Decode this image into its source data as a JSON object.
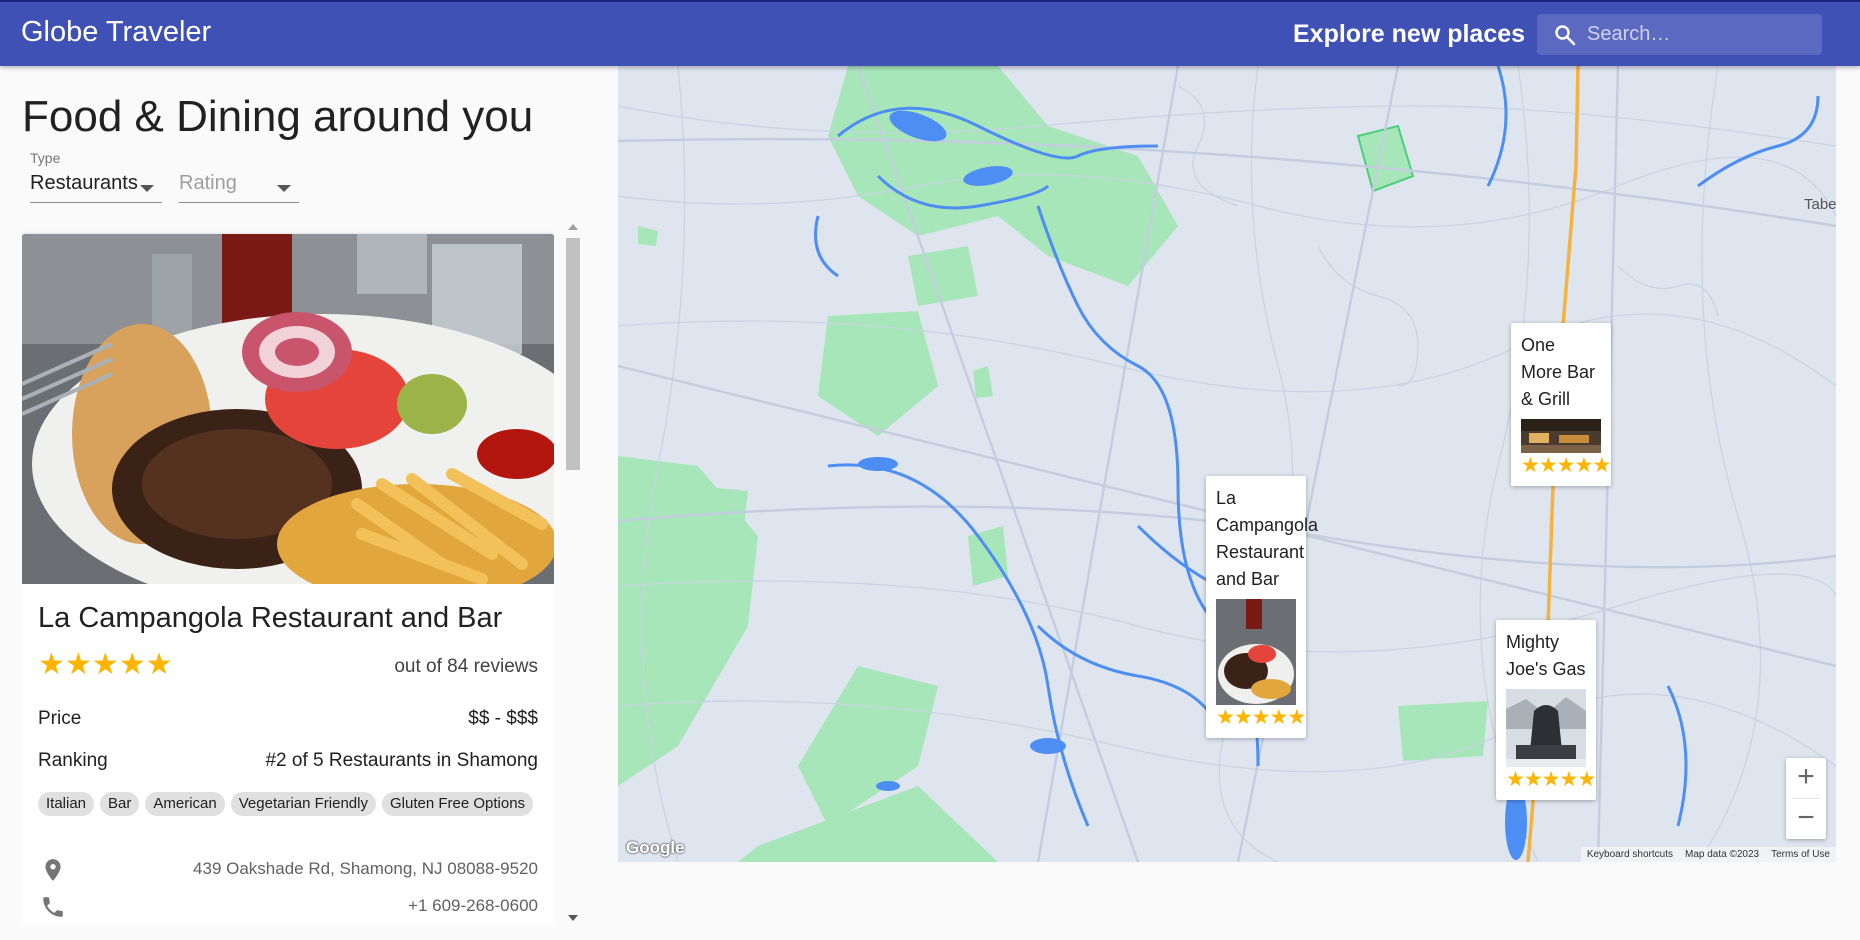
{
  "app": {
    "title": "Globe Traveler",
    "tagline": "Explore new places",
    "search_placeholder": "Search…"
  },
  "page": {
    "heading": "Food & Dining around you",
    "filters": {
      "type_label": "Type",
      "type_value": "Restaurants",
      "rating_value": "Rating"
    }
  },
  "card": {
    "name": "La Campangola Restaurant and Bar",
    "rating_stars": 5,
    "reviews_text": "out of 84 reviews",
    "price_label": "Price",
    "price_value": "$$ - $$$",
    "ranking_label": "Ranking",
    "ranking_value": "#2 of 5 Restaurants in Shamong",
    "tags": [
      "Italian",
      "Bar",
      "American",
      "Vegetarian Friendly",
      "Gluten Free Options"
    ],
    "address": "439 Oakshade Rd, Shamong, NJ 08088-9520",
    "phone": "+1 609-268-0600"
  },
  "map": {
    "place_label": "Tabe",
    "logo_text": "Google",
    "footer": [
      "Keyboard shortcuts",
      "Map data ©2023",
      "Terms of Use"
    ],
    "zoom_in": "+",
    "zoom_out": "−",
    "markers": [
      {
        "name": "One More Bar & Grill",
        "stars": 5
      },
      {
        "name": "La Campangola Restaurant and Bar",
        "stars": 5
      },
      {
        "name": "Mighty Joe's Gas",
        "stars": 5
      }
    ]
  },
  "icons": {
    "search": "search-icon",
    "location": "location-pin-icon",
    "phone": "phone-icon"
  },
  "colors": {
    "appbar": "#3f51b5",
    "star": "#ffb400",
    "map_land": "#dfe5ef",
    "map_park": "#a6e6b8",
    "map_water": "#4d8ef5",
    "highway": "#f5b23c"
  }
}
